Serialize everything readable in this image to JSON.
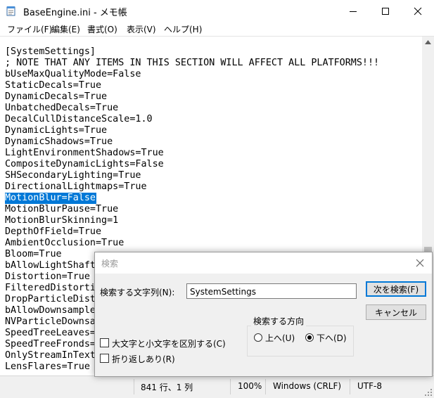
{
  "window": {
    "title": "BaseEngine.ini - メモ帳"
  },
  "menu": [
    {
      "label": "ファイル(F)"
    },
    {
      "label": "編集(E)"
    },
    {
      "label": "書式(O)"
    },
    {
      "label": "表示(V)"
    },
    {
      "label": "ヘルプ(H)"
    }
  ],
  "editor": {
    "lines": [
      "[SystemSettings]",
      "; NOTE THAT ANY ITEMS IN THIS SECTION WILL AFFECT ALL PLATFORMS!!!",
      "bUseMaxQualityMode=False",
      "StaticDecals=True",
      "DynamicDecals=True",
      "UnbatchedDecals=True",
      "DecalCullDistanceScale=1.0",
      "DynamicLights=True",
      "DynamicShadows=True",
      "LightEnvironmentShadows=True",
      "CompositeDynamicLights=False",
      "SHSecondaryLighting=True",
      "DirectionalLightmaps=True",
      "MotionBlur=False",
      "MotionBlurPause=True",
      "MotionBlurSkinning=1",
      "DepthOfField=True",
      "AmbientOcclusion=True",
      "Bloom=True",
      "bAllowLightShaft",
      "Distortion=True",
      "FilteredDistorti",
      "DropParticleDist",
      "bAllowDownsample",
      "NVParticleDownsa",
      "SpeedTreeLeaves=",
      "SpeedTreeFronds=",
      "OnlyStreamInText",
      "LensFlares=True"
    ],
    "selected_line": "MotionBlur=False"
  },
  "status": {
    "position": "841 行、1 列",
    "zoom": "100%",
    "line_ending": "Windows (CRLF)",
    "encoding": "UTF-8"
  },
  "find_dialog": {
    "title": "検索",
    "search_label": "検索する文字列(N):",
    "search_value": "SystemSettings",
    "find_next_label": "次を検索(F)",
    "cancel_label": "キャンセル",
    "direction_label": "検索する方向",
    "up_label": "上へ(U)",
    "down_label": "下へ(D)",
    "selected_direction": "down",
    "match_case_label": "大文字と小文字を区別する(C)",
    "wrap_label": "折り返しあり(R)"
  },
  "colors": {
    "selection": "#0078d7",
    "default_button_border": "#0078d7"
  }
}
